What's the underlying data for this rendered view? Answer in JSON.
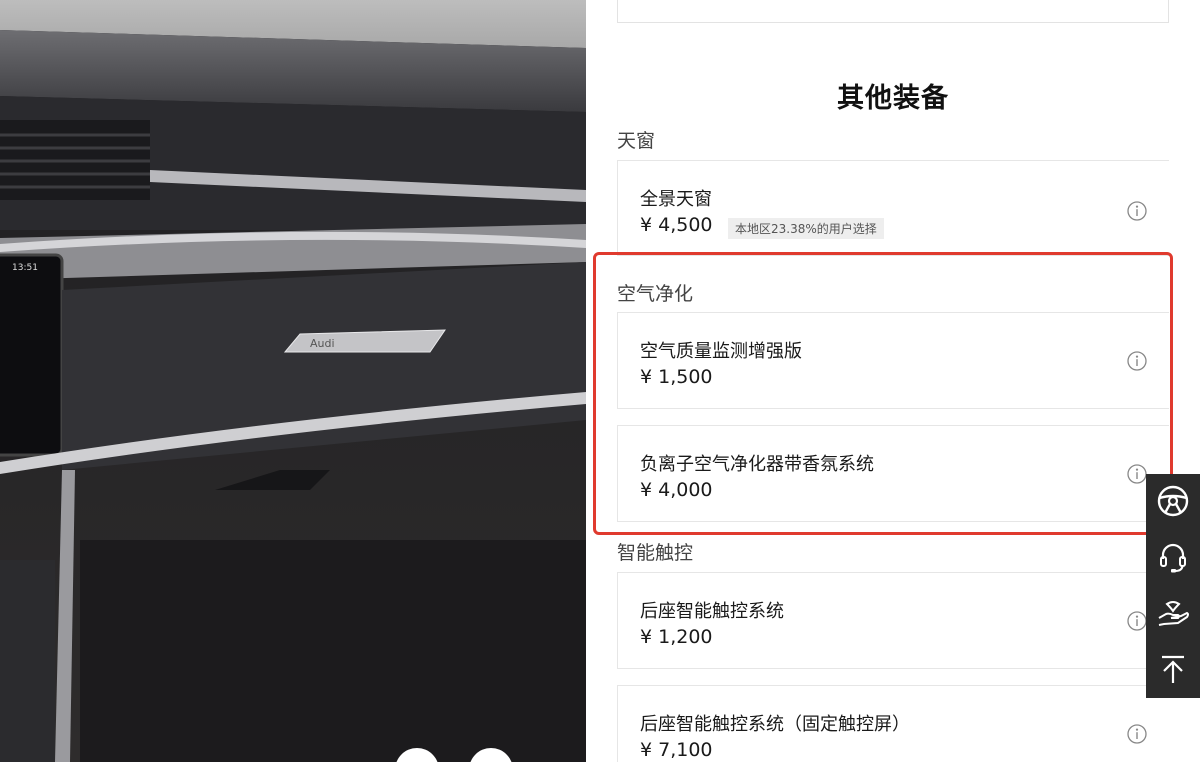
{
  "hero": {
    "clock_text": "13:51",
    "brand_badge_text": "Audi"
  },
  "panel": {
    "section_title": "其他装备",
    "groups": [
      {
        "label": "天窗",
        "options": [
          {
            "name": "全景天窗",
            "price": "¥ 4,500",
            "tag": "本地区23.38%的用户选择"
          }
        ]
      },
      {
        "label": "空气净化",
        "options": [
          {
            "name": "空气质量监测增强版",
            "price": "¥ 1,500"
          },
          {
            "name": "负离子空气净化器带香氛系统",
            "price": "¥ 4,000"
          }
        ]
      },
      {
        "label": "智能触控",
        "options": [
          {
            "name": "后座智能触控系统",
            "price": "¥ 1,200"
          },
          {
            "name": "后座智能触控系统（固定触控屏）",
            "price": "¥ 7,100"
          }
        ]
      }
    ]
  },
  "highlight_color": "#e03a2e",
  "float_toolbar": {
    "buttons": [
      "steering-wheel-icon",
      "headset-icon",
      "hand-heart-icon",
      "back-to-top-icon"
    ]
  }
}
